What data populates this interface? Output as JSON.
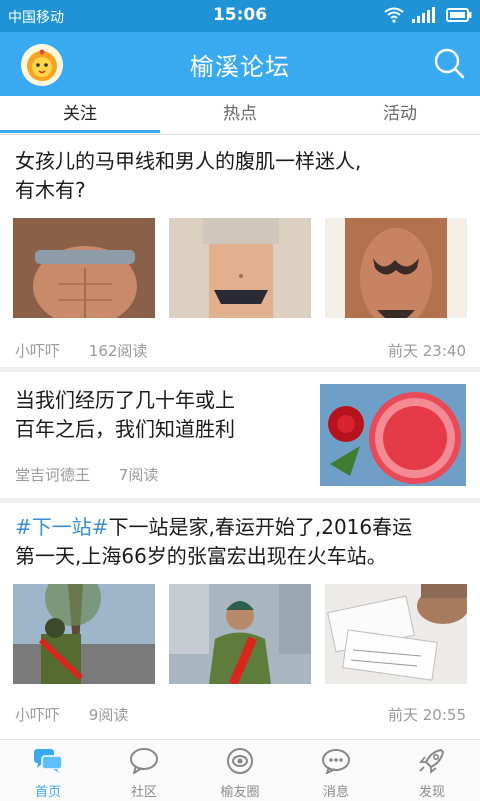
{
  "status_bar": {
    "carrier": "中国移动",
    "time": "15:06"
  },
  "header": {
    "title": "榆溪论坛",
    "avatar_icon": "lion-avatar-icon",
    "search_icon": "search-icon"
  },
  "tabs": [
    {
      "label": "关注",
      "active": true
    },
    {
      "label": "热点",
      "active": false
    },
    {
      "label": "活动",
      "active": false
    }
  ],
  "posts": [
    {
      "title_line1": "女孩儿的马甲线和男人的腹肌一样迷人,",
      "title_line2": "有木有?",
      "author": "小吓吓",
      "reads": "162阅读",
      "time": "前天 23:40"
    },
    {
      "title_line1": "当我们经历了几十年或上",
      "title_line2": "百年之后，我们知道胜利",
      "author": "堂吉诃德王",
      "reads": "7阅读"
    },
    {
      "tag": "#下一站#",
      "title_line1_rest": "下一站是家,春运开始了,2016春运",
      "title_line2": "第一天,上海66岁的张富宏出现在火车站。",
      "author": "小吓吓",
      "reads": "9阅读",
      "time": "前天 20:55"
    }
  ],
  "bottom_nav": [
    {
      "label": "首页",
      "icon": "home-chat-icon",
      "active": true
    },
    {
      "label": "社区",
      "icon": "speech-bubble-icon",
      "active": false
    },
    {
      "label": "榆友圈",
      "icon": "eye-circle-icon",
      "active": false
    },
    {
      "label": "消息",
      "icon": "message-dots-icon",
      "active": false
    },
    {
      "label": "发现",
      "icon": "rocket-icon",
      "active": false
    }
  ],
  "colors": {
    "status_bar": "#1f93d5",
    "app_bar": "#39aaf0",
    "accent": "#39aaf0",
    "tag": "#3a8ed6"
  }
}
